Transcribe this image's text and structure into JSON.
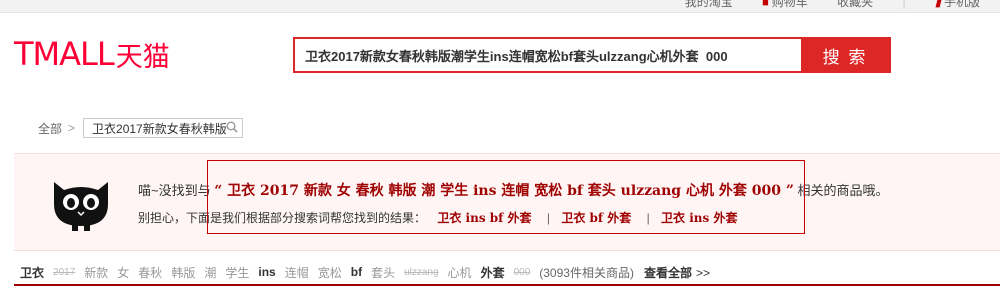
{
  "topbar": {
    "links": [
      "我的淘宝",
      "购物车",
      "收藏夹",
      "手机版"
    ]
  },
  "logo": {
    "en": "TMALL",
    "cn": "天猫"
  },
  "search": {
    "value": "卫衣2017新款女春秋韩版潮学生ins连帽宽松bf套头ulzzang心机外套  000",
    "button": "搜 索"
  },
  "breadcrumb": {
    "root": "全部",
    "arrow": ">",
    "keyword": "卫衣2017新款女春秋韩版"
  },
  "notice": {
    "prefix": "喵~没找到与",
    "keyword": "“ 卫衣 2017 新款 女 春秋 韩版 潮 学生 ins 连帽 宽松 bf 套头 ulzzang 心机 外套 000 ”",
    "suffix": "相关的商品哦。",
    "hint": "别担心，下面是我们根据部分搜索词帮您找到的结果：",
    "suggestions": [
      "卫衣 ins bf 外套",
      "卫衣 bf 外套",
      "卫衣 ins 外套"
    ],
    "divider": "|"
  },
  "terms": {
    "items": [
      {
        "text": "卫衣",
        "state": "hit"
      },
      {
        "text": "2017",
        "state": "miss"
      },
      {
        "text": "新款",
        "state": "normal"
      },
      {
        "text": "女",
        "state": "normal"
      },
      {
        "text": "春秋",
        "state": "normal"
      },
      {
        "text": "韩版",
        "state": "normal"
      },
      {
        "text": "潮",
        "state": "normal"
      },
      {
        "text": "学生",
        "state": "normal"
      },
      {
        "text": "ins",
        "state": "hit"
      },
      {
        "text": "连帽",
        "state": "normal"
      },
      {
        "text": "宽松",
        "state": "normal"
      },
      {
        "text": "bf",
        "state": "hit"
      },
      {
        "text": "套头",
        "state": "normal"
      },
      {
        "text": "ulzzang",
        "state": "miss"
      },
      {
        "text": "心机",
        "state": "normal"
      },
      {
        "text": "外套",
        "state": "hit"
      },
      {
        "text": "000",
        "state": "miss"
      }
    ],
    "count": "(3093件相关商品)",
    "view_all": "查看全部",
    "chevron": ">>"
  },
  "colors": {
    "brand": "#ff0036",
    "accent": "#dd2727",
    "keyword": "#9f0000"
  }
}
